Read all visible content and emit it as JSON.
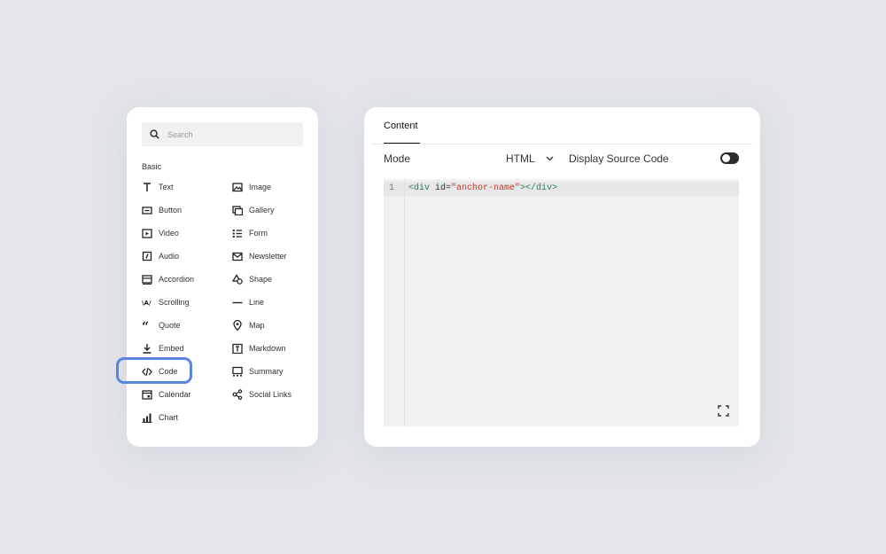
{
  "block_picker": {
    "search_placeholder": "Search",
    "section_title": "Basic",
    "items_left": [
      {
        "label": "Text",
        "icon": "text-icon"
      },
      {
        "label": "Button",
        "icon": "button-icon"
      },
      {
        "label": "Video",
        "icon": "video-icon"
      },
      {
        "label": "Audio",
        "icon": "audio-icon"
      },
      {
        "label": "Accordion",
        "icon": "accordion-icon"
      },
      {
        "label": "Scrolling",
        "icon": "scrolling-icon"
      },
      {
        "label": "Quote",
        "icon": "quote-icon"
      },
      {
        "label": "Embed",
        "icon": "embed-icon"
      },
      {
        "label": "Code",
        "icon": "code-icon",
        "highlighted": true
      },
      {
        "label": "Calendar",
        "icon": "calendar-icon"
      },
      {
        "label": "Chart",
        "icon": "chart-icon"
      }
    ],
    "items_right": [
      {
        "label": "Image",
        "icon": "image-icon"
      },
      {
        "label": "Gallery",
        "icon": "gallery-icon"
      },
      {
        "label": "Form",
        "icon": "form-icon"
      },
      {
        "label": "Newsletter",
        "icon": "newsletter-icon"
      },
      {
        "label": "Shape",
        "icon": "shape-icon"
      },
      {
        "label": "Line",
        "icon": "line-icon"
      },
      {
        "label": "Map",
        "icon": "map-pin-icon"
      },
      {
        "label": "Markdown",
        "icon": "markdown-icon"
      },
      {
        "label": "Summary",
        "icon": "summary-icon"
      },
      {
        "label": "Social Links",
        "icon": "social-links-icon"
      }
    ]
  },
  "editor_panel": {
    "tab_label": "Content",
    "mode_label": "Mode",
    "mode_value": "HTML",
    "display_source_label": "Display Source Code",
    "display_source_enabled": true,
    "line_number": "1",
    "code": {
      "open_tag": "<div",
      "attr": " id=",
      "value": "\"anchor-name\"",
      "close": "></div>"
    }
  },
  "colors": {
    "highlight_border": "#5a85dc",
    "string": "#c0392b",
    "tag": "#2e7d5b"
  }
}
